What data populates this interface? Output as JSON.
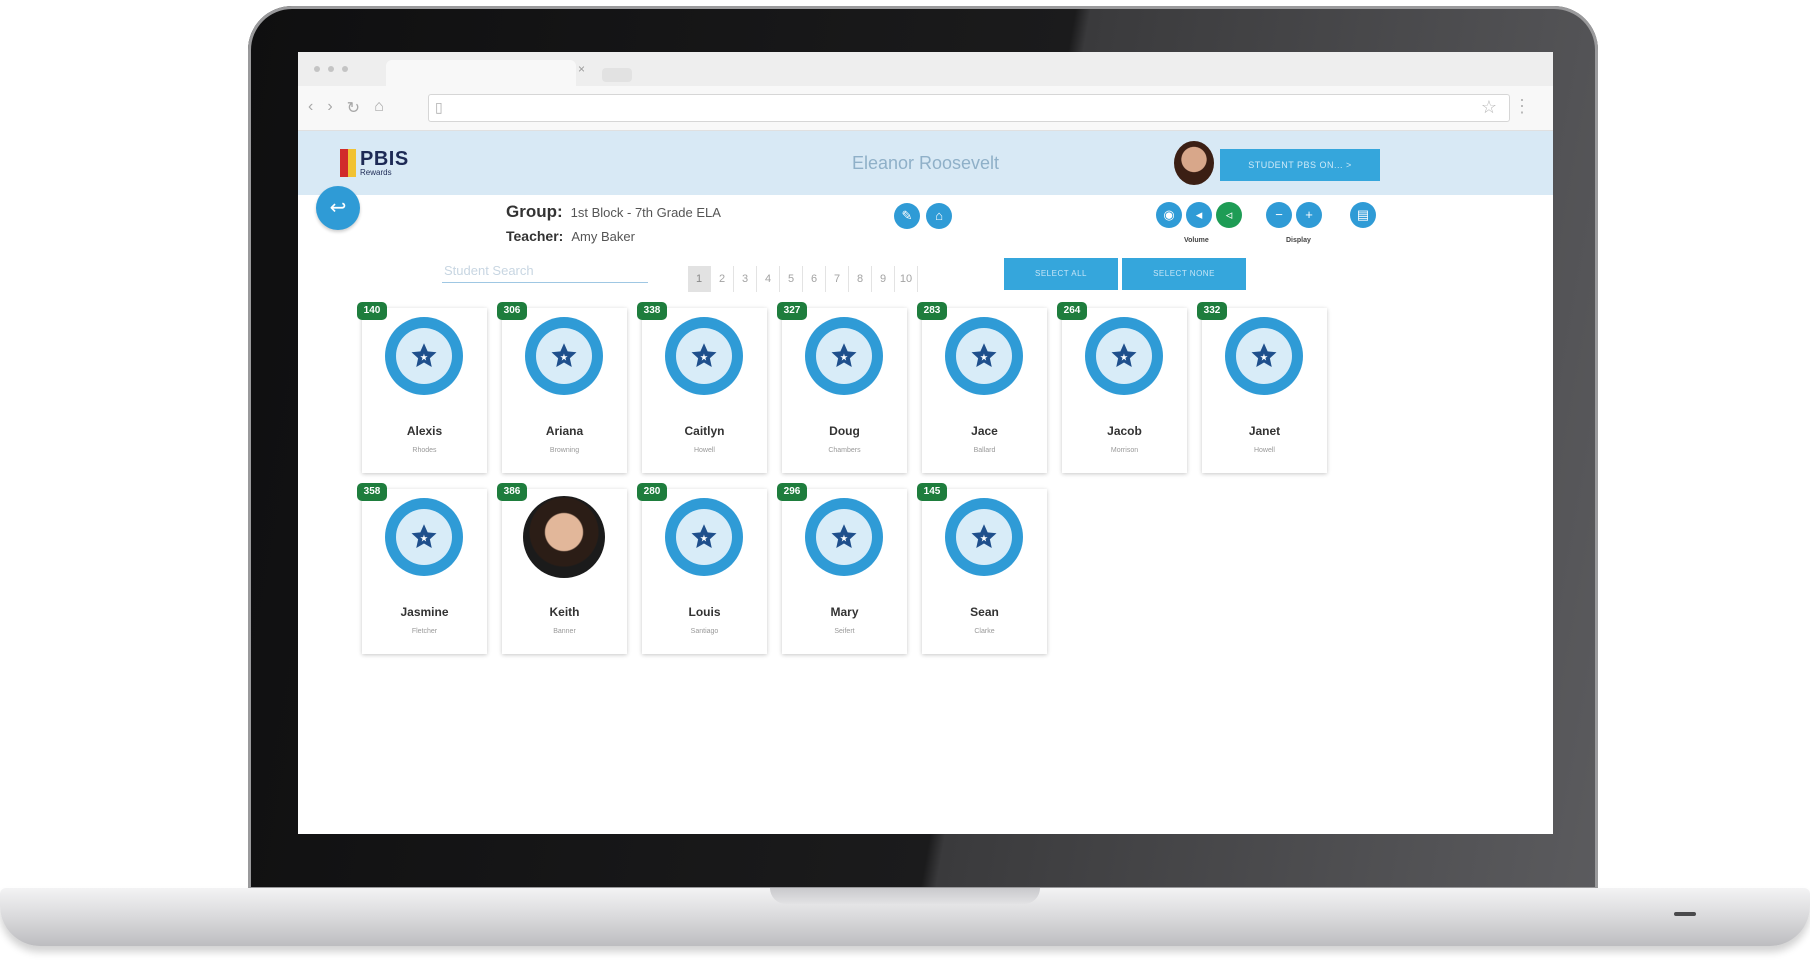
{
  "app": {
    "logo_title": "PBIS",
    "logo_subtitle": "Rewards",
    "school_name": "Eleanor Roosevelt",
    "header_button": "STUDENT PBS ON... >"
  },
  "group": {
    "group_label": "Group:",
    "group_value": "1st Block - 7th Grade ELA",
    "teacher_label": "Teacher:",
    "teacher_value": "Amy Baker"
  },
  "controls": {
    "volume_label": "Volume",
    "display_label": "Display"
  },
  "search": {
    "placeholder": "Student Search"
  },
  "pagination": [
    "1",
    "2",
    "3",
    "4",
    "5",
    "6",
    "7",
    "8",
    "9",
    "10"
  ],
  "pagination_active": "1",
  "actions": {
    "select_all": "SELECT ALL",
    "select_none": "SELECT NONE"
  },
  "students": [
    {
      "points": "140",
      "first": "Alexis",
      "last": "Rhodes",
      "avatar": "star"
    },
    {
      "points": "306",
      "first": "Ariana",
      "last": "Browning",
      "avatar": "star"
    },
    {
      "points": "338",
      "first": "Caitlyn",
      "last": "Howell",
      "avatar": "star"
    },
    {
      "points": "327",
      "first": "Doug",
      "last": "Chambers",
      "avatar": "star"
    },
    {
      "points": "283",
      "first": "Jace",
      "last": "Ballard",
      "avatar": "star"
    },
    {
      "points": "264",
      "first": "Jacob",
      "last": "Morrison",
      "avatar": "star"
    },
    {
      "points": "332",
      "first": "Janet",
      "last": "Howell",
      "avatar": "star"
    },
    {
      "points": "358",
      "first": "Jasmine",
      "last": "Fletcher",
      "avatar": "star"
    },
    {
      "points": "386",
      "first": "Keith",
      "last": "Banner",
      "avatar": "photo"
    },
    {
      "points": "280",
      "first": "Louis",
      "last": "Santiago",
      "avatar": "star"
    },
    {
      "points": "296",
      "first": "Mary",
      "last": "Seifert",
      "avatar": "star"
    },
    {
      "points": "145",
      "first": "Sean",
      "last": "Clarke",
      "avatar": "star"
    }
  ],
  "colors": {
    "primary": "#2f9bd6",
    "header_bg": "#d8e9f5",
    "points_badge": "#1e7d3d",
    "green_button": "#1e9c55"
  }
}
